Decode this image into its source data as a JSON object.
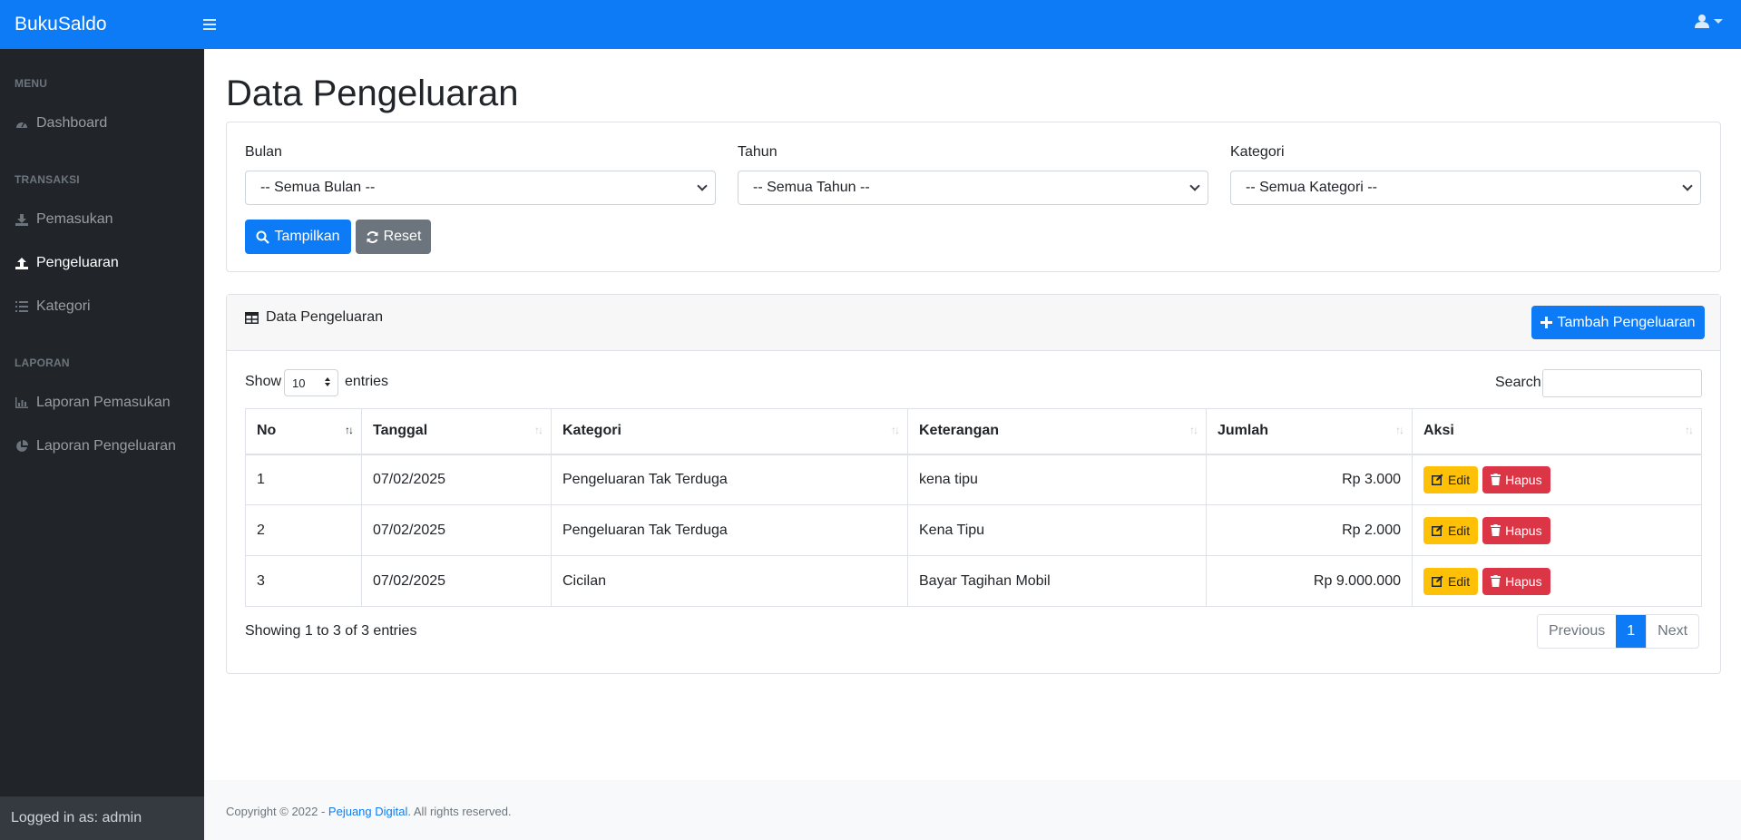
{
  "app": {
    "brand": "BukuSaldo"
  },
  "sidebar": {
    "sections": [
      {
        "heading": "MENU"
      },
      {
        "heading": "TRANSAKSI"
      },
      {
        "heading": "LAPORAN"
      }
    ],
    "items": [
      {
        "label": "Dashboard",
        "icon": "dashboard-gauge-icon"
      },
      {
        "label": "Pemasukan",
        "icon": "download-icon"
      },
      {
        "label": "Pengeluaran",
        "icon": "upload-icon",
        "active": true
      },
      {
        "label": "Kategori",
        "icon": "list-icon"
      },
      {
        "label": "Laporan Pemasukan",
        "icon": "bar-chart-icon"
      },
      {
        "label": "Laporan Pengeluaran",
        "icon": "pie-chart-icon"
      }
    ],
    "footer": "Logged in as: admin"
  },
  "page": {
    "title": "Data Pengeluaran"
  },
  "filters": {
    "bulan": {
      "label": "Bulan",
      "value": "-- Semua Bulan --"
    },
    "tahun": {
      "label": "Tahun",
      "value": "-- Semua Tahun --"
    },
    "kategori": {
      "label": "Kategori",
      "value": "-- Semua Kategori --"
    },
    "show_button": "Tampilkan",
    "reset_button": "Reset"
  },
  "table_card": {
    "title": "Data Pengeluaran",
    "add_button": "Tambah Pengeluaran",
    "show_label": "Show",
    "page_length": "10",
    "entries_label": "entries",
    "search_label": "Search:",
    "columns": [
      "No",
      "Tanggal",
      "Kategori",
      "Keterangan",
      "Jumlah",
      "Aksi"
    ],
    "rows": [
      {
        "no": "1",
        "tanggal": "07/02/2025",
        "kategori": "Pengeluaran Tak Terduga",
        "keterangan": "kena tipu",
        "jumlah": "Rp 3.000"
      },
      {
        "no": "2",
        "tanggal": "07/02/2025",
        "kategori": "Pengeluaran Tak Terduga",
        "keterangan": "Kena Tipu",
        "jumlah": "Rp 2.000"
      },
      {
        "no": "3",
        "tanggal": "07/02/2025",
        "kategori": "Cicilan",
        "keterangan": "Bayar Tagihan Mobil",
        "jumlah": "Rp 9.000.000"
      }
    ],
    "edit_label": "Edit",
    "delete_label": "Hapus",
    "info": "Showing 1 to 3 of 3 entries",
    "pagination": {
      "previous": "Previous",
      "current": "1",
      "next": "Next"
    }
  },
  "footer": {
    "prefix": "Copyright © 2022 - ",
    "link": "Pejuang Digital",
    "suffix": ". All rights reserved."
  },
  "colors": {
    "primary": "#0d7bf6",
    "sidebar": "#212529",
    "warning": "#ffc107",
    "danger": "#dc3545"
  }
}
